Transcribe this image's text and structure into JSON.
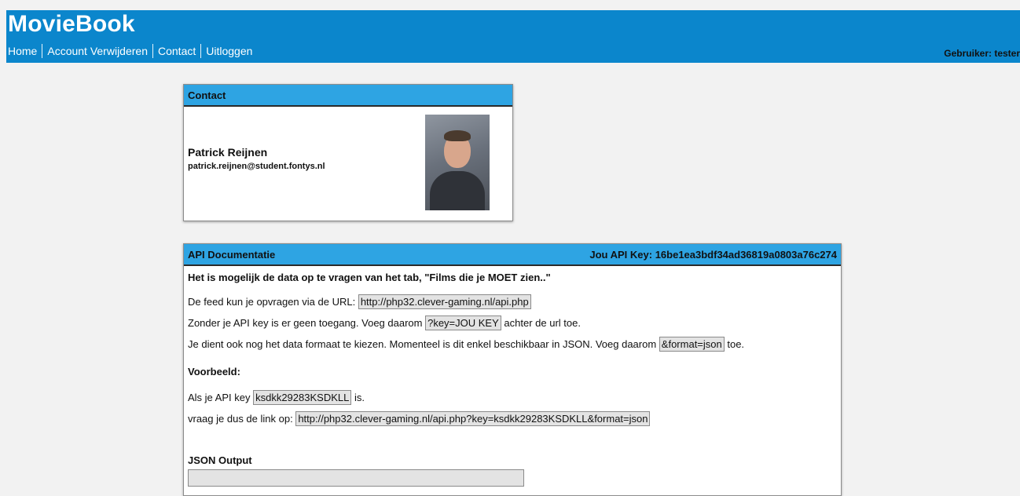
{
  "app": {
    "title": "MovieBook"
  },
  "nav": {
    "items": [
      {
        "label": "Home"
      },
      {
        "label": "Account Verwijderen"
      },
      {
        "label": "Contact"
      },
      {
        "label": "Uitloggen"
      }
    ],
    "user_label": "Gebruiker: tester"
  },
  "contact": {
    "header": "Contact",
    "name": "Patrick Reijnen",
    "email": "patrick.reijnen@student.fontys.nl"
  },
  "api": {
    "header": "API Documentatie",
    "key_label": "Jou API Key: 16be1ea3bdf34ad36819a0803a76c274",
    "lead": "Het is mogelijk de data op te vragen van het tab, \"Films die je MOET zien..\"",
    "line1_before": "De feed kun je opvragen via de URL: ",
    "line1_code": "http://php32.clever-gaming.nl/api.php",
    "line2_before": "Zonder je API key is er geen toegang. Voeg daarom ",
    "line2_code": "?key=JOU KEY",
    "line2_after": " achter de url toe.",
    "line3_before": "Je dient ook nog het data formaat te kiezen. Momenteel is dit enkel beschikbaar in JSON. Voeg daarom ",
    "line3_code": "&format=json",
    "line3_after": " toe.",
    "example_title": "Voorbeeld:",
    "ex1_before": "Als je API key ",
    "ex1_code": "ksdkk29283KSDKLL",
    "ex1_after": " is.",
    "ex2_before": "vraag je dus de link op: ",
    "ex2_code": "http://php32.clever-gaming.nl/api.php?key=ksdkk29283KSDKLL&format=json",
    "json_title": "JSON Output"
  },
  "colors": {
    "topbar": "#0b86cc",
    "card_header": "#2ea4e3",
    "background": "#f2f2f2"
  }
}
